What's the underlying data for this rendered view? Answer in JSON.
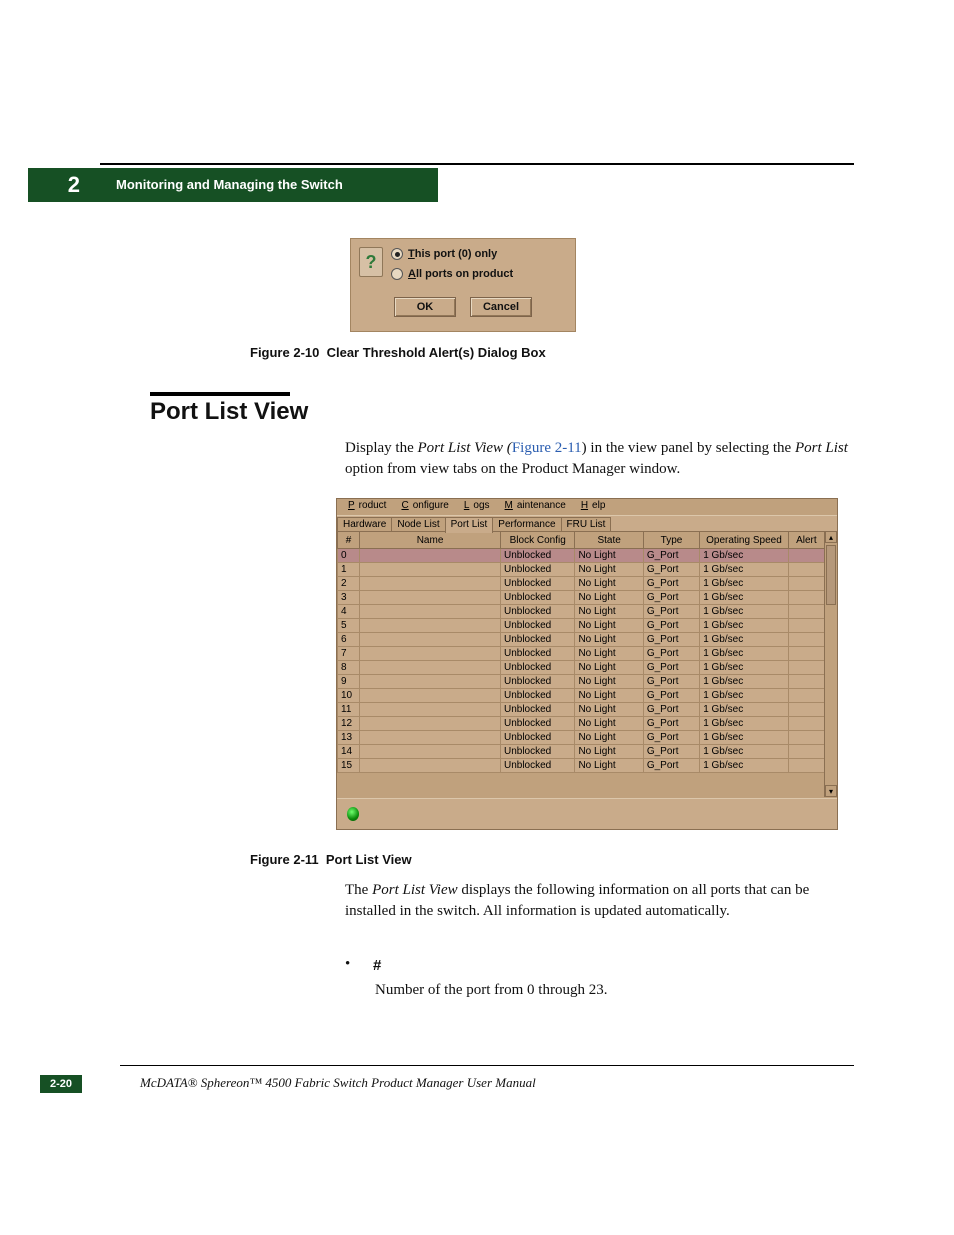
{
  "side_tab": "2",
  "tab_title": "Monitoring and Managing the Switch",
  "dialog": {
    "opt_this": "This port (0) only",
    "opt_all": "All ports on product",
    "ok": "OK",
    "cancel": "Cancel"
  },
  "fig10_label": "Figure 2-10",
  "fig10_title": "Clear Threshold Alert(s) Dialog Box",
  "section_head": "Port List View",
  "para1_pre": "Display the ",
  "para1_it1": "Port List View (",
  "para1_link": "Figure 2-11",
  "para1_mid": ") in the view panel by selecting the ",
  "para1_it2": "Port List",
  "para1_post": " option from view tabs on the Product Manager window.",
  "plv": {
    "menu": {
      "m1": "Product",
      "m2": "Configure",
      "m3": "Logs",
      "m4": "Maintenance",
      "m5": "Help"
    },
    "tabs": {
      "t1": "Hardware",
      "t2": "Node List",
      "t3": "Port List",
      "t4": "Performance",
      "t5": "FRU List"
    },
    "cols": {
      "c1": "#",
      "c2": "Name",
      "c3": "Block Config",
      "c4": "State",
      "c5": "Type",
      "c6": "Operating Speed",
      "c7": "Alert"
    },
    "rows": [
      {
        "n": "0",
        "name": "",
        "bc": "Unblocked",
        "st": "No Light",
        "ty": "G_Port",
        "sp": "1 Gb/sec",
        "al": ""
      },
      {
        "n": "1",
        "name": "",
        "bc": "Unblocked",
        "st": "No Light",
        "ty": "G_Port",
        "sp": "1 Gb/sec",
        "al": ""
      },
      {
        "n": "2",
        "name": "",
        "bc": "Unblocked",
        "st": "No Light",
        "ty": "G_Port",
        "sp": "1 Gb/sec",
        "al": ""
      },
      {
        "n": "3",
        "name": "",
        "bc": "Unblocked",
        "st": "No Light",
        "ty": "G_Port",
        "sp": "1 Gb/sec",
        "al": ""
      },
      {
        "n": "4",
        "name": "",
        "bc": "Unblocked",
        "st": "No Light",
        "ty": "G_Port",
        "sp": "1 Gb/sec",
        "al": ""
      },
      {
        "n": "5",
        "name": "",
        "bc": "Unblocked",
        "st": "No Light",
        "ty": "G_Port",
        "sp": "1 Gb/sec",
        "al": ""
      },
      {
        "n": "6",
        "name": "",
        "bc": "Unblocked",
        "st": "No Light",
        "ty": "G_Port",
        "sp": "1 Gb/sec",
        "al": ""
      },
      {
        "n": "7",
        "name": "",
        "bc": "Unblocked",
        "st": "No Light",
        "ty": "G_Port",
        "sp": "1 Gb/sec",
        "al": ""
      },
      {
        "n": "8",
        "name": "",
        "bc": "Unblocked",
        "st": "No Light",
        "ty": "G_Port",
        "sp": "1 Gb/sec",
        "al": ""
      },
      {
        "n": "9",
        "name": "",
        "bc": "Unblocked",
        "st": "No Light",
        "ty": "G_Port",
        "sp": "1 Gb/sec",
        "al": ""
      },
      {
        "n": "10",
        "name": "",
        "bc": "Unblocked",
        "st": "No Light",
        "ty": "G_Port",
        "sp": "1 Gb/sec",
        "al": ""
      },
      {
        "n": "11",
        "name": "",
        "bc": "Unblocked",
        "st": "No Light",
        "ty": "G_Port",
        "sp": "1 Gb/sec",
        "al": ""
      },
      {
        "n": "12",
        "name": "",
        "bc": "Unblocked",
        "st": "No Light",
        "ty": "G_Port",
        "sp": "1 Gb/sec",
        "al": ""
      },
      {
        "n": "13",
        "name": "",
        "bc": "Unblocked",
        "st": "No Light",
        "ty": "G_Port",
        "sp": "1 Gb/sec",
        "al": ""
      },
      {
        "n": "14",
        "name": "",
        "bc": "Unblocked",
        "st": "No Light",
        "ty": "G_Port",
        "sp": "1 Gb/sec",
        "al": ""
      },
      {
        "n": "15",
        "name": "",
        "bc": "Unblocked",
        "st": "No Light",
        "ty": "G_Port",
        "sp": "1 Gb/sec",
        "al": ""
      }
    ]
  },
  "fig11_label": "Figure 2-11",
  "fig11_title": "Port List View",
  "para2_pre": "The ",
  "para2_it": "Port List View",
  "para2_post": " displays the following information on all ports that can be installed in the switch. All information is updated automatically.",
  "bullet_head": "#",
  "bullet_body": "Number of the port from 0 through 23.",
  "page_num": "2-20",
  "footer_text": "McDATA® Sphereon™ 4500 Fabric Switch Product Manager User Manual"
}
